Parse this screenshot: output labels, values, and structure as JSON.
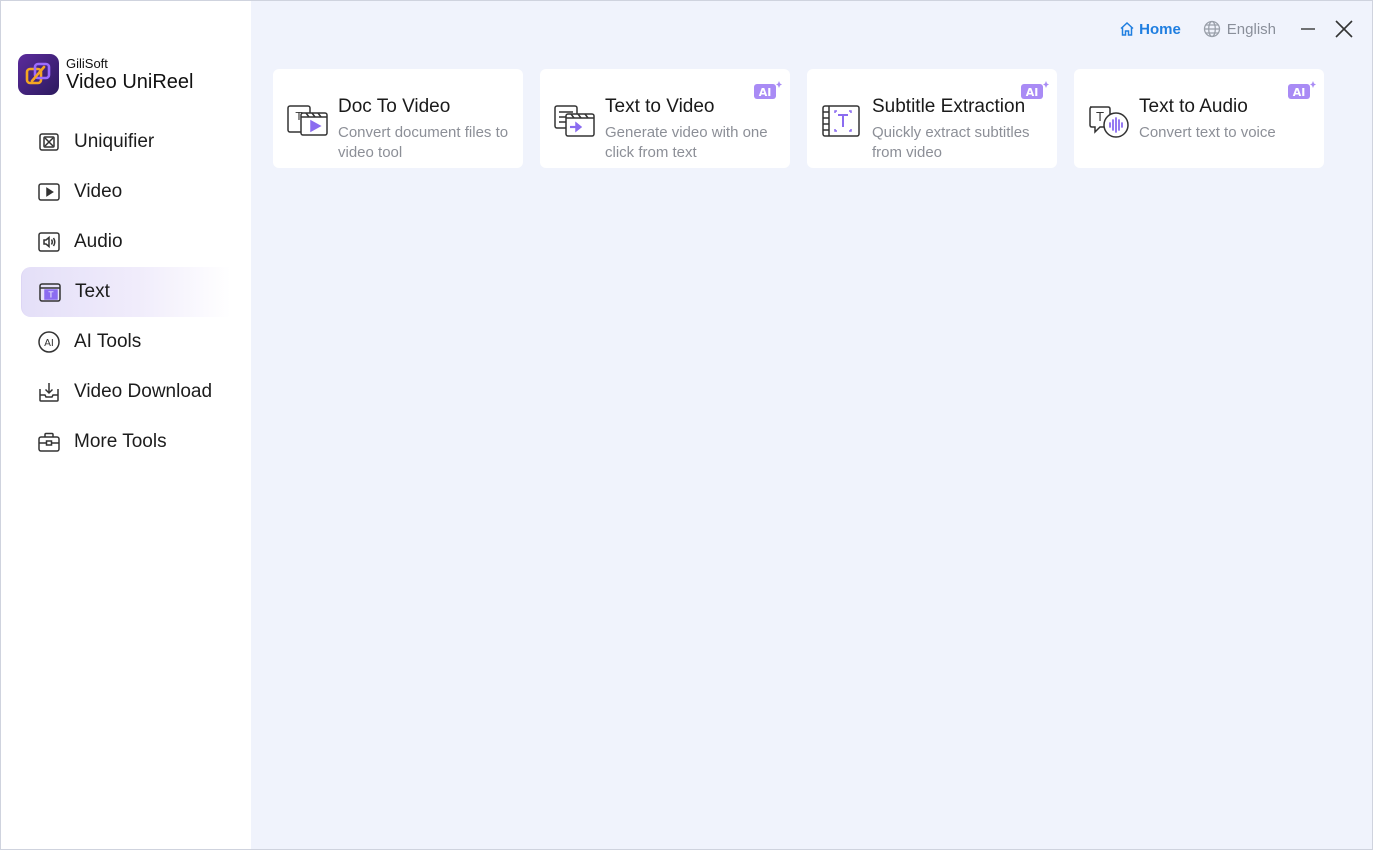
{
  "app": {
    "brand_small": "GiliSoft",
    "brand_name": "Video UniReel"
  },
  "sidebar": {
    "items": [
      {
        "label": "Uniquifier",
        "icon": "uniquifier-icon"
      },
      {
        "label": "Video",
        "icon": "video-icon"
      },
      {
        "label": "Audio",
        "icon": "audio-icon"
      },
      {
        "label": "Text",
        "icon": "text-icon",
        "active": true
      },
      {
        "label": "AI Tools",
        "icon": "ai-tools-icon"
      },
      {
        "label": "Video Download",
        "icon": "video-download-icon"
      },
      {
        "label": "More Tools",
        "icon": "toolbox-icon"
      }
    ]
  },
  "topbar": {
    "home_label": "Home",
    "language_label": "English"
  },
  "cards": [
    {
      "title": "Doc To Video",
      "desc": "Convert document files to video tool",
      "ai": false
    },
    {
      "title": "Text to Video",
      "desc": "Generate video with one click from text",
      "ai": true,
      "badge": "AI"
    },
    {
      "title": "Subtitle Extraction",
      "desc": "Quickly extract subtitles from video",
      "ai": true,
      "badge": "AI"
    },
    {
      "title": "Text to Audio",
      "desc": "Convert text to voice",
      "ai": true,
      "badge": "AI"
    }
  ],
  "colors": {
    "accent_blue": "#1f7ee0",
    "accent_purple": "#8b6cf0",
    "background": "#f0f3fc"
  }
}
